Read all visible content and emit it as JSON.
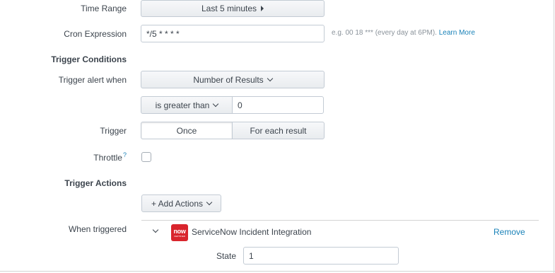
{
  "form": {
    "time_range": {
      "label": "Time Range",
      "value": "Last 5 minutes"
    },
    "cron": {
      "label": "Cron Expression",
      "value": "*/5 * * * *",
      "hint": "e.g. 00 18 *** (every day at 6PM).",
      "learn_more": "Learn More"
    },
    "trigger_conditions": {
      "heading": "Trigger Conditions",
      "trigger_alert_label": "Trigger alert when",
      "trigger_alert_value": "Number of Results",
      "comparator": "is greater than",
      "threshold": "0",
      "trigger_label": "Trigger",
      "trigger_options": [
        "Once",
        "For each result"
      ],
      "trigger_selected": "Once",
      "throttle_label": "Throttle",
      "throttle_help": "?",
      "throttle_checked": false
    },
    "trigger_actions": {
      "heading": "Trigger Actions",
      "add_actions": "+ Add Actions",
      "when_triggered_label": "When triggered",
      "integration": {
        "name": "ServiceNow Incident Integration",
        "logo_text": "now",
        "logo_subtext": "CERTIFIED",
        "logo_color": "#d9252d",
        "remove": "Remove",
        "state_label": "State",
        "state_value": "1"
      }
    }
  },
  "colors": {
    "link": "#1a82b8",
    "text": "#3c444d",
    "border": "#c3cbd4"
  }
}
